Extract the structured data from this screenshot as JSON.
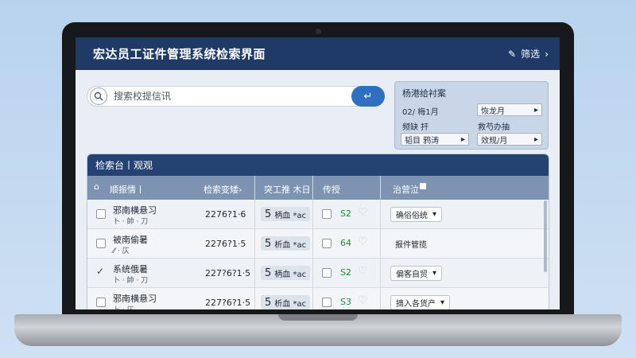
{
  "header": {
    "title": "宏达员工证件管理系统检索界面",
    "filter_label": "筛选",
    "filter_icon": "pencil-icon",
    "chevron": "›"
  },
  "search": {
    "placeholder": "搜索校提信讯",
    "go_icon": "enter-icon"
  },
  "filter_panel": {
    "title": "杨港给衬案",
    "r1_left": "02/ 梅1月",
    "r1_right": "恢龙月",
    "r2_left": "频缺 扞",
    "r2_right": "救芍办抽",
    "r3_left": "韬目 鸦涛",
    "r3_right": "效规/月"
  },
  "table": {
    "title": "检索台丨观观",
    "columns": [
      "顺振情丨",
      "检索变矮›",
      "突工推 木日",
      "传授",
      "治营泣"
    ],
    "rows": [
      {
        "checked": false,
        "name": "邪南横悬习",
        "sub": "卜 · 帥 · 刀",
        "num": "2276?1·6",
        "tag_num": "5",
        "tag": "柄血 *ac",
        "gnum": "S2",
        "action": "确俗俗统",
        "action_style": "box"
      },
      {
        "checked": false,
        "name": "被南偷暑",
        "sub": "⁄⁄ · 仄",
        "num": "2276?1·5",
        "tag_num": "5",
        "tag": "析血 *ac",
        "gnum": "64",
        "action": "报件管揽",
        "action_style": "plain"
      },
      {
        "checked": true,
        "name": "系统俄暑",
        "sub": "卜 · 帥 · 刀",
        "num": "227?6?1·5",
        "tag_num": "5",
        "tag": "柄血 *ac",
        "gnum": "S2",
        "action": "偏客自贸",
        "action_style": "box"
      },
      {
        "checked": false,
        "name": "邪南横悬习",
        "sub": "卜 · 仄",
        "num": "227?6?1·5",
        "tag_num": "5",
        "tag": "析血 *ac",
        "gnum": "S3",
        "action": "摘入各货产",
        "action_style": "box"
      }
    ]
  },
  "colors": {
    "header": "#1f3a66",
    "accent": "#2f6fc0",
    "green": "#1f8a3c"
  }
}
